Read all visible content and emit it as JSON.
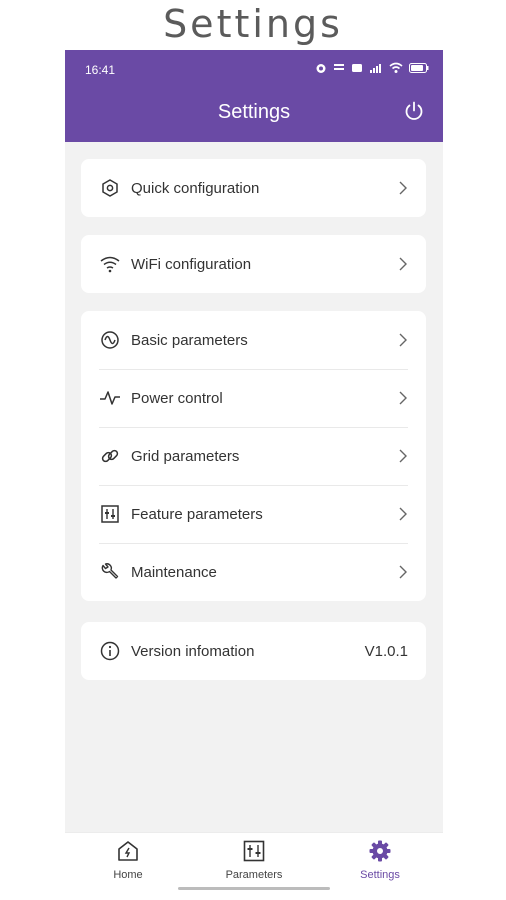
{
  "caption": "Settings",
  "status_bar": {
    "time": "16:41"
  },
  "header": {
    "title": "Settings"
  },
  "groups": [
    {
      "items": [
        {
          "label": "Quick configuration",
          "icon": "hexagon-icon"
        }
      ]
    },
    {
      "items": [
        {
          "label": "WiFi configuration",
          "icon": "wifi-icon"
        }
      ]
    },
    {
      "items": [
        {
          "label": "Basic parameters",
          "icon": "wave-icon"
        },
        {
          "label": "Power control",
          "icon": "pulse-icon"
        },
        {
          "label": "Grid parameters",
          "icon": "link-icon"
        },
        {
          "label": "Feature parameters",
          "icon": "sliders-icon"
        },
        {
          "label": "Maintenance",
          "icon": "wrench-icon"
        }
      ]
    },
    {
      "items": [
        {
          "label": "Version infomation",
          "icon": "info-icon",
          "value": "V1.0.1"
        }
      ]
    }
  ],
  "tabs": [
    {
      "label": "Home",
      "icon": "home-icon"
    },
    {
      "label": "Parameters",
      "icon": "parameters-icon"
    },
    {
      "label": "Settings",
      "icon": "settings-gear-icon",
      "active": true
    }
  ],
  "colors": {
    "primary": "#6a4aa5",
    "background": "#f2f2f2"
  }
}
